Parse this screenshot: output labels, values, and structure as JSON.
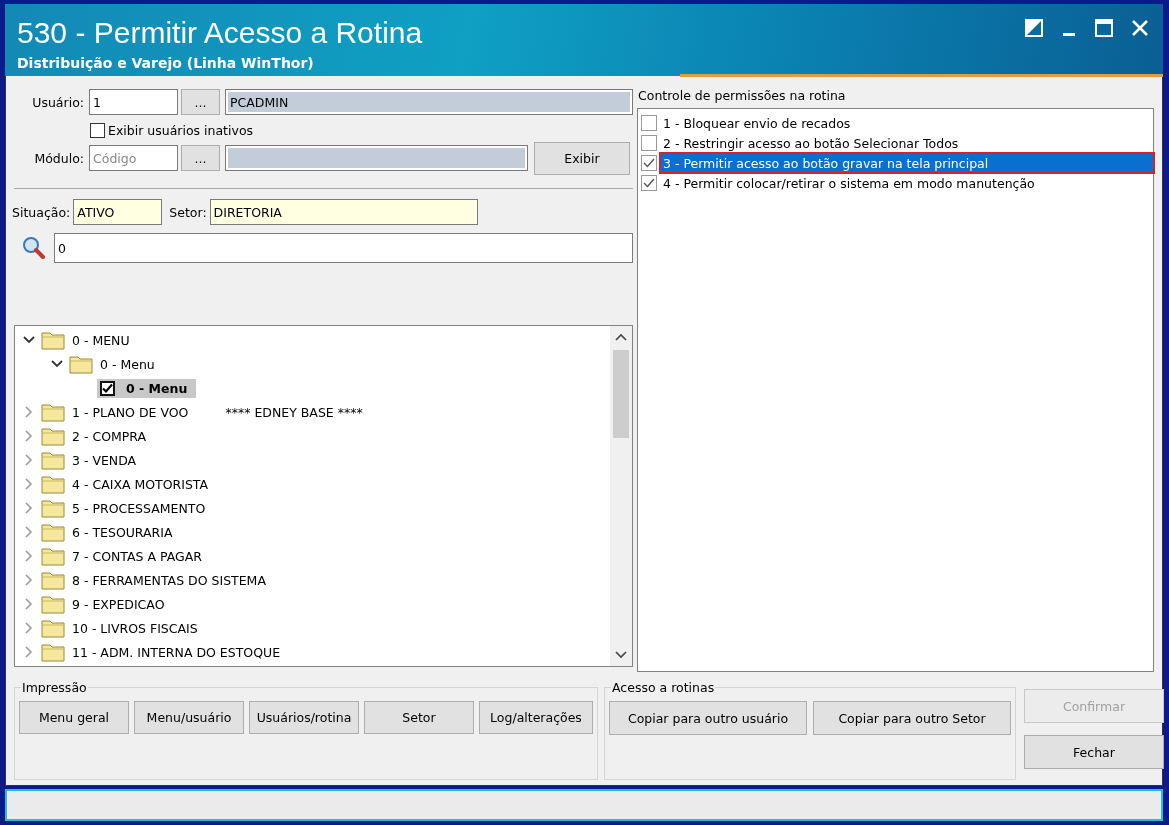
{
  "window": {
    "title": "530 - Permitir Acesso a Rotina",
    "subtitle": "Distribuição e Varejo (Linha WinThor)"
  },
  "user": {
    "label": "Usuário:",
    "code": "1",
    "lookup": "...",
    "name": "PCADMIN"
  },
  "show_inactive": {
    "label": "Exibir usuários inativos",
    "checked": false
  },
  "module": {
    "label": "Módulo:",
    "placeholder": "Código",
    "lookup": "...",
    "show_button": "Exibir"
  },
  "situation": {
    "label": "Situação:",
    "value": "ATIVO"
  },
  "sector": {
    "label": "Setor:",
    "value": "DIRETORIA"
  },
  "search": {
    "value": "0"
  },
  "tree": [
    {
      "label": "0 - MENU",
      "kind": "folder",
      "expanded": true,
      "children": [
        {
          "label": "0 - Menu",
          "kind": "folder",
          "expanded": true,
          "children": [
            {
              "label": "0 - Menu",
              "kind": "check",
              "checked": true,
              "selected": true
            }
          ]
        }
      ]
    },
    {
      "label": "1 - PLANO DE VOO",
      "note": "**** EDNEY BASE ****",
      "kind": "folder",
      "expanded": false
    },
    {
      "label": "2 - COMPRA",
      "kind": "folder",
      "expanded": false
    },
    {
      "label": "3 - VENDA",
      "kind": "folder",
      "expanded": false
    },
    {
      "label": "4 - CAIXA MOTORISTA",
      "kind": "folder",
      "expanded": false
    },
    {
      "label": "5 - PROCESSAMENTO",
      "kind": "folder",
      "expanded": false
    },
    {
      "label": "6 - TESOURARIA",
      "kind": "folder",
      "expanded": false
    },
    {
      "label": "7 - CONTAS A PAGAR",
      "kind": "folder",
      "expanded": false
    },
    {
      "label": "8 - FERRAMENTAS DO SISTEMA",
      "kind": "folder",
      "expanded": false
    },
    {
      "label": "9 - EXPEDICAO",
      "kind": "folder",
      "expanded": false
    },
    {
      "label": "10 - LIVROS FISCAIS",
      "kind": "folder",
      "expanded": false
    },
    {
      "label": "11 - ADM. INTERNA DO ESTOQUE",
      "kind": "folder",
      "expanded": false
    }
  ],
  "permissions": {
    "title": "Controle de permissões na rotina",
    "items": [
      {
        "label": "1 - Bloquear envio de recados",
        "checked": false,
        "selected": false,
        "callout": false
      },
      {
        "label": "2 - Restringir acesso ao botão Selecionar Todos",
        "checked": false,
        "selected": false,
        "callout": false
      },
      {
        "label": "3 - Permitir acesso ao botão gravar na tela principal",
        "checked": true,
        "selected": true,
        "callout": true
      },
      {
        "label": "4 - Permitir colocar/retirar o sistema em modo manutenção",
        "checked": true,
        "selected": false,
        "callout": false
      }
    ]
  },
  "print_group": {
    "title": "Impressão",
    "buttons": [
      "Menu geral",
      "Menu/usuário",
      "Usuários/rotina",
      "Setor",
      "Log/alterações"
    ]
  },
  "access_group": {
    "title": "Acesso a rotinas",
    "buttons": [
      "Copiar para outro usuário",
      "Copiar para outro Setor"
    ]
  },
  "dialog_buttons": [
    {
      "label": "Confirmar",
      "disabled": true
    },
    {
      "label": "Fechar",
      "disabled": false
    }
  ]
}
